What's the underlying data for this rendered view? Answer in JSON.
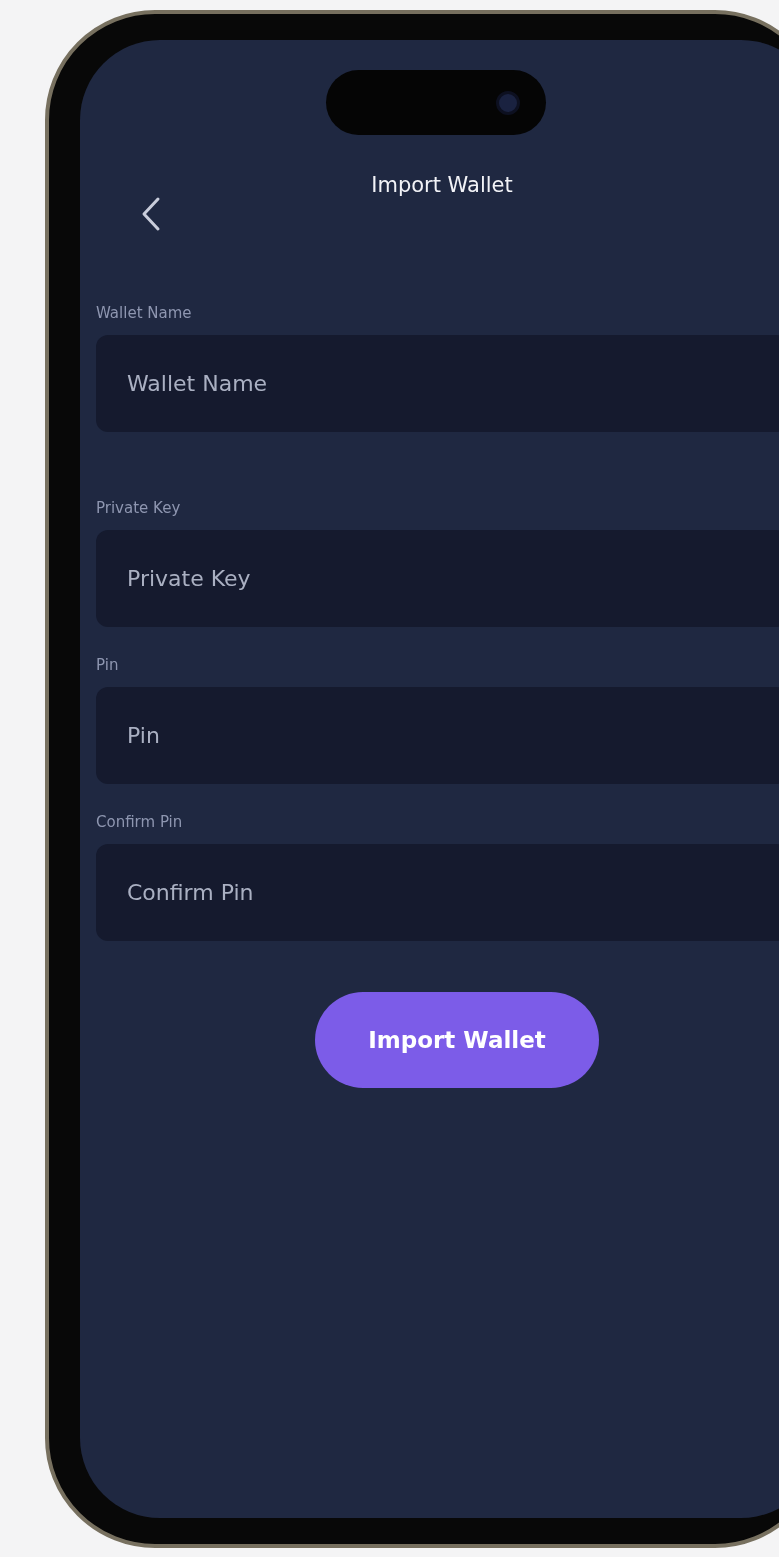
{
  "header": {
    "title": "Import Wallet"
  },
  "fields": [
    {
      "label": "Wallet Name",
      "placeholder": "Wallet Name"
    },
    {
      "label": "Private Key",
      "placeholder": "Private Key"
    },
    {
      "label": "Pin",
      "placeholder": "Pin"
    },
    {
      "label": "Confirm Pin",
      "placeholder": "Confirm Pin"
    }
  ],
  "button": {
    "label": "Import Wallet"
  }
}
